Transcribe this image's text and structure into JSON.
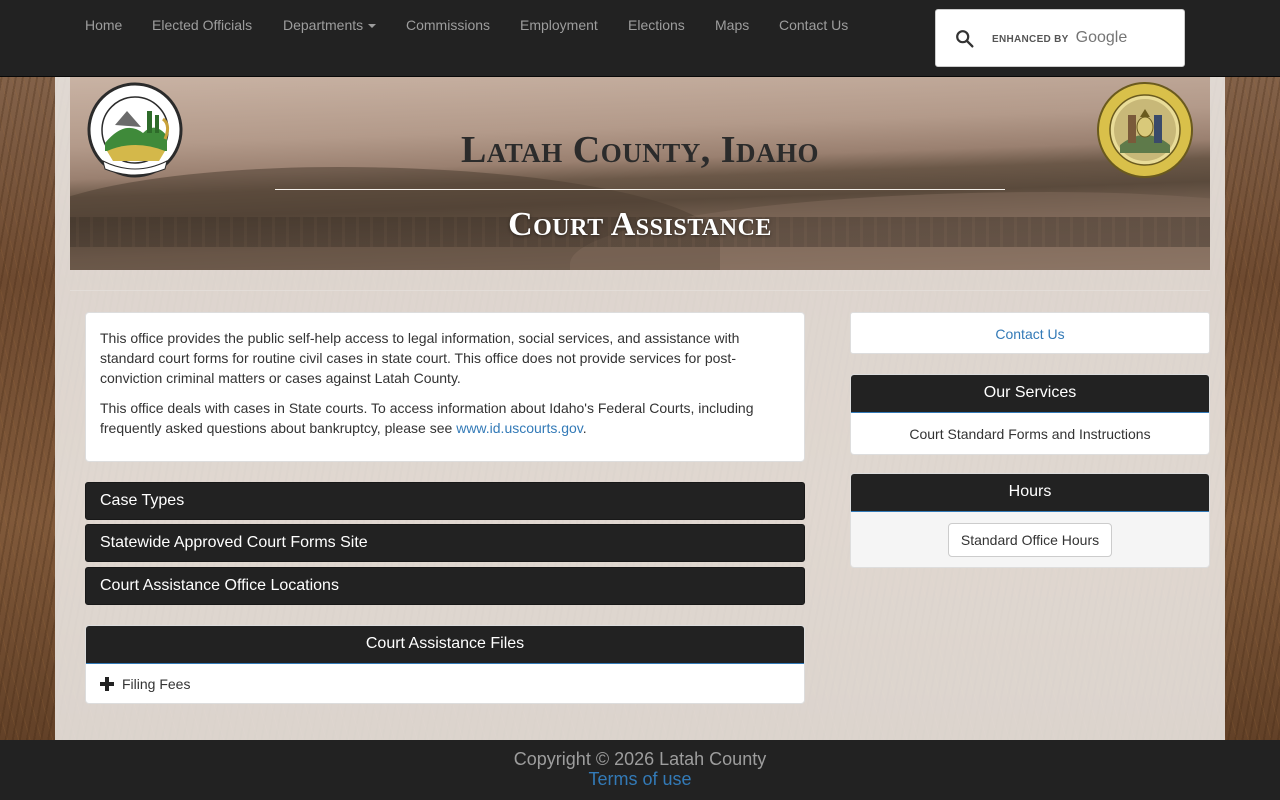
{
  "nav": {
    "items": [
      "Home",
      "Elected Officials",
      "Departments",
      "Commissions",
      "Employment",
      "Elections",
      "Maps",
      "Contact Us"
    ],
    "search": {
      "enhanced_by": "ENHANCED BY",
      "brand": "Google"
    }
  },
  "banner": {
    "county_title": "Latah County, Idaho",
    "page_title": "Court Assistance",
    "left_logo_icon": "latah-county-seal-icon",
    "right_logo_icon": "idaho-state-seal-icon"
  },
  "intro": {
    "p1": "This office provides the public self-help access to legal information, social services, and assistance with standard court forms for routine civil cases in state court. This office does not provide services for post-conviction criminal matters or cases against Latah County.",
    "p2_prefix": "This office deals with cases in State courts. To access information about Idaho's Federal Courts, including frequently asked questions about bankruptcy, please see ",
    "p2_link": "www.id.uscourts.gov",
    "p2_suffix": "."
  },
  "accordion": [
    "Case Types",
    "Statewide Approved Court Forms Site",
    "Court Assistance Office Locations"
  ],
  "files": {
    "heading": "Court Assistance Files",
    "items": [
      "Filing Fees"
    ]
  },
  "sidebar": {
    "contact_label": "Contact Us",
    "services_heading": "Our Services",
    "services_item": "Court Standard Forms and Instructions",
    "hours_heading": "Hours",
    "hours_button": "Standard Office Hours"
  },
  "footer": {
    "copyright": "Copyright © 2026 Latah County",
    "terms": "Terms of use"
  },
  "colors": {
    "navbar": "#222222",
    "link": "#337ab7",
    "nav_text": "#9d9d9d"
  }
}
